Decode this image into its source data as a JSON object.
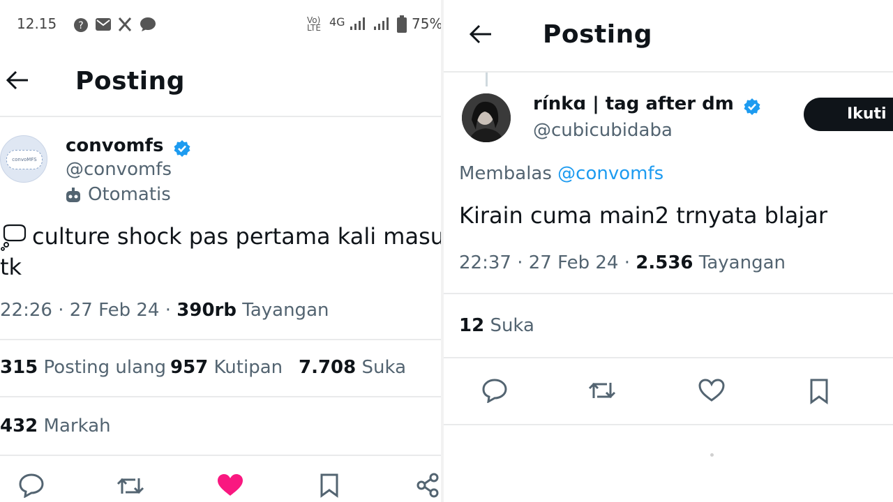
{
  "status_bar": {
    "time": "12.15",
    "network": "4G",
    "battery": "75%"
  },
  "left": {
    "header_title": "Posting",
    "author": {
      "name": "convomfs",
      "handle": "@convomfs",
      "avatar_text": "convoMFS",
      "badge": "Otomatis"
    },
    "post": {
      "line1": "culture shock pas pertama kali masuk",
      "line2": "tk",
      "time": "22:26",
      "date": "27 Feb 24",
      "views": "390rb",
      "views_label": "Tayangan"
    },
    "stats": {
      "reposts": "315",
      "reposts_label": "Posting ulang",
      "quotes": "957",
      "quotes_label": "Kutipan",
      "likes": "7.708",
      "likes_label": "Suka",
      "bookmarks": "432",
      "bookmarks_label": "Markah"
    },
    "actions": [
      "reply-icon",
      "repost-icon",
      "heart-filled-icon",
      "bookmark-icon",
      "share-icon"
    ]
  },
  "right": {
    "header_title": "Posting",
    "author": {
      "name": "rínkɑ | tag after dm",
      "handle": "@cubicubidaba",
      "follow_label": "Ikuti"
    },
    "reply_label": "Membalas",
    "reply_to": "@convomfs",
    "post": {
      "text": "Kirain cuma main2 trnyata blajar",
      "time": "22:37",
      "date": "27 Feb 24",
      "views": "2.536",
      "views_label": "Tayangan"
    },
    "stats": {
      "likes": "12",
      "likes_label": "Suka"
    },
    "actions": [
      "reply-icon",
      "repost-icon",
      "heart-icon",
      "bookmark-icon"
    ]
  },
  "colors": {
    "verified": "#1d9bf0",
    "like": "#f91880",
    "link": "#1d9bf0"
  }
}
